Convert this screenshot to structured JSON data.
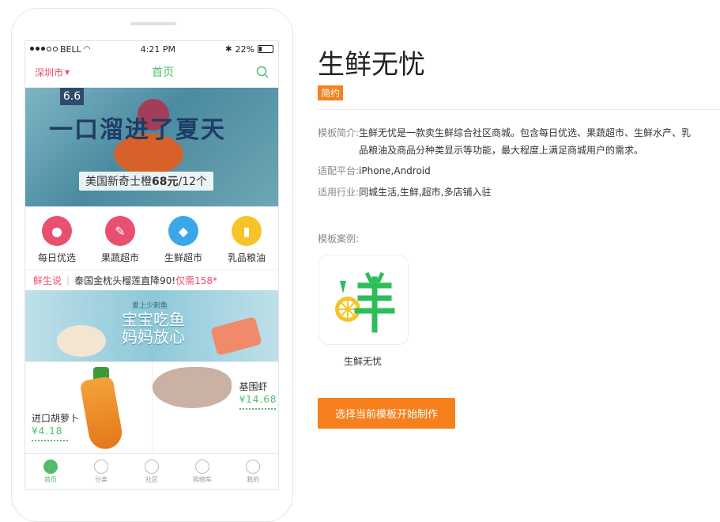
{
  "status_bar": {
    "carrier": "BELL",
    "time": "4:21 PM",
    "battery": "22%"
  },
  "nav": {
    "city": "深圳市",
    "title": "首页"
  },
  "banner": {
    "date": "6.6",
    "slogan": "一口溜进了夏天",
    "caption_prefix": "美国新奇士橙",
    "caption_price": "68元",
    "caption_suffix": "/12个"
  },
  "categories": [
    {
      "label": "每日优选",
      "color": "#e94f6e",
      "icon": "grape-icon"
    },
    {
      "label": "果蔬超市",
      "color": "#e94f6e",
      "icon": "carrot-icon"
    },
    {
      "label": "生鲜超市",
      "color": "#3aa7e8",
      "icon": "fish-icon"
    },
    {
      "label": "乳品粮油",
      "color": "#f6c428",
      "icon": "milk-icon"
    }
  ],
  "news": {
    "tag": "鲜生说",
    "text": "泰国金枕头榴莲直降90!",
    "price": "仅需158*"
  },
  "promo": {
    "small": "爱上少刺鱼",
    "big_line1": "宝宝吃鱼",
    "big_line2": "妈妈放心"
  },
  "products": [
    {
      "name": "进口胡萝卜",
      "price": "¥4.18"
    },
    {
      "name": "基围虾",
      "price": "¥14.68"
    }
  ],
  "tabs": [
    {
      "label": "首页",
      "icon": "home-icon",
      "active": true
    },
    {
      "label": "分类",
      "icon": "category-icon",
      "active": false
    },
    {
      "label": "社区",
      "icon": "community-icon",
      "active": false
    },
    {
      "label": "购物车",
      "icon": "cart-icon",
      "active": false
    },
    {
      "label": "我的",
      "icon": "user-icon",
      "active": false
    }
  ],
  "template": {
    "title": "生鲜无忧",
    "badge": "简约",
    "desc_label": "模板简介:",
    "desc": "生鲜无忧是一款卖生鲜综合社区商城。包含每日优选、果蔬超市、生鲜水产、乳品粮油及商品分种类显示等功能，最大程度上满足商城用户的需求。",
    "platform_label": "适配平台:",
    "platform": "iPhone,Android",
    "industry_label": "适用行业:",
    "industry": "同城生活,生鲜,超市,多店铺入驻",
    "case_label": "模板案例:",
    "case_name": "生鲜无忧",
    "logo_char": "鲜",
    "cta": "选择当前模板开始制作"
  },
  "colors": {
    "accent": "#f7801e",
    "green": "#4fbd6d",
    "pink": "#e94f6e"
  }
}
